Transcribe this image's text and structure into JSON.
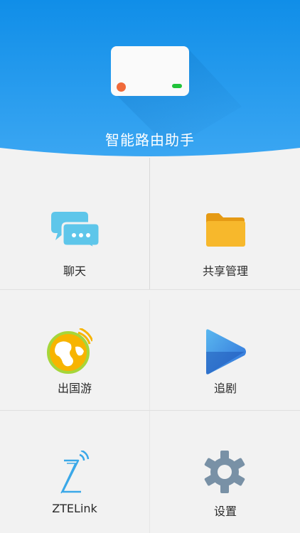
{
  "app": {
    "title": "智能路由助手"
  },
  "colors": {
    "header_top": "#108ee8",
    "header_bottom": "#3aa6f2",
    "grid_bg": "#f2f2f2",
    "chat_icon": "#5ec6ea",
    "folder_icon": "#f7b82c",
    "globe_green": "#a6d63a",
    "globe_orange": "#f7b400",
    "play_blue": "#3a8ae8",
    "zte_blue": "#3aa8e8",
    "gear_gray": "#7991a6"
  },
  "menu": {
    "items": [
      {
        "label": "聊天",
        "icon": "chat-bubbles-icon"
      },
      {
        "label": "共享管理",
        "icon": "folder-icon"
      },
      {
        "label": "出国游",
        "icon": "globe-icon"
      },
      {
        "label": "追剧",
        "icon": "play-icon"
      },
      {
        "label": "ZTELink",
        "icon": "ztelink-icon"
      },
      {
        "label": "设置",
        "icon": "gear-icon"
      }
    ]
  }
}
